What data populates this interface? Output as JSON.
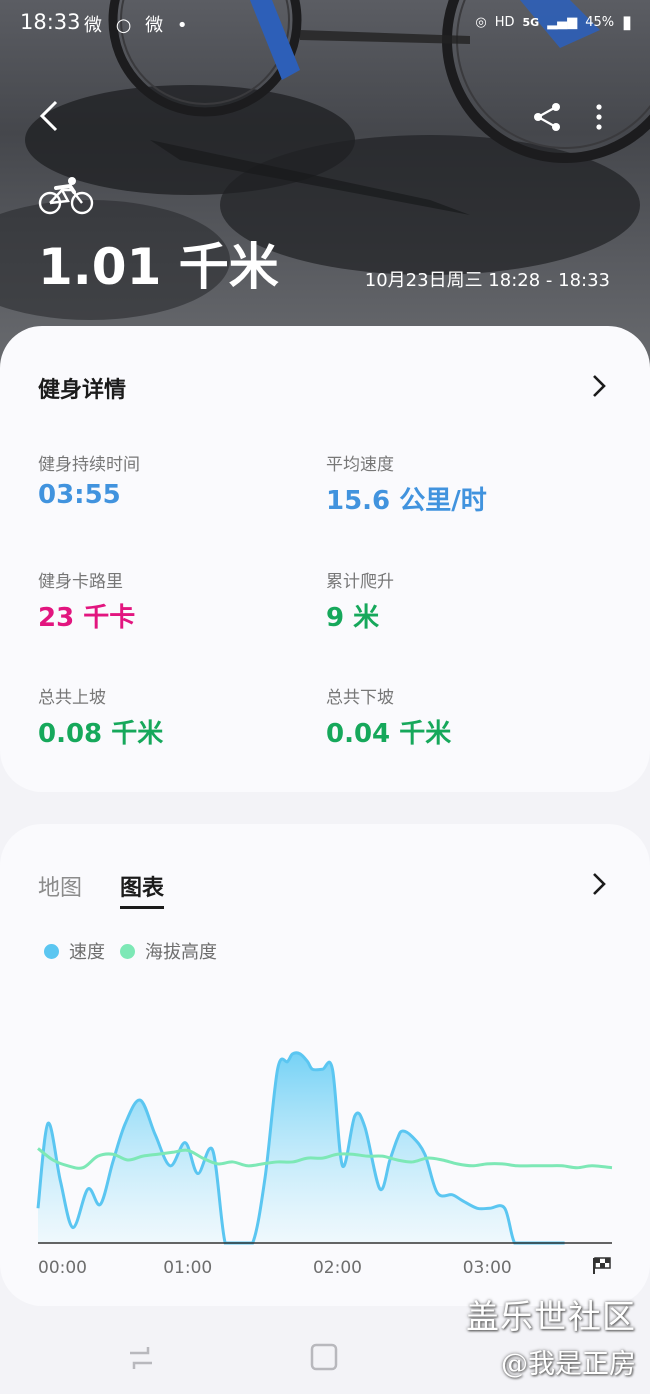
{
  "status_bar": {
    "time": "18:33",
    "left_icons": "微 ○ 微 •",
    "hd": "HD",
    "network": "5G",
    "battery": "45%"
  },
  "hero": {
    "activity_icon": "cycling-icon",
    "distance": "1.01 千米",
    "datetime": "10月23日周三 18:28 - 18:33"
  },
  "details": {
    "title": "健身详情",
    "stats": [
      {
        "label": "健身持续时间",
        "value": "03:55",
        "color": "#4193de"
      },
      {
        "label": "平均速度",
        "value": "15.6 公里/时",
        "color": "#4193de"
      },
      {
        "label": "健身卡路里",
        "value": "23 千卡",
        "color": "#e2157f"
      },
      {
        "label": "累计爬升",
        "value": "9 米",
        "color": "#16a85b"
      },
      {
        "label": "总共上坡",
        "value": "0.08 千米",
        "color": "#16a85b"
      },
      {
        "label": "总共下坡",
        "value": "0.04 千米",
        "color": "#16a85b"
      }
    ]
  },
  "chart_section": {
    "tabs": [
      {
        "label": "地图",
        "selected": false
      },
      {
        "label": "图表",
        "selected": true
      }
    ],
    "legend": [
      {
        "label": "速度",
        "color": "#5bc6f1"
      },
      {
        "label": "海拔高度",
        "color": "#7de8b6"
      }
    ]
  },
  "chart_data": {
    "type": "area",
    "x_unit": "minutes",
    "x_ticks": [
      "00:00",
      "01:00",
      "02:00",
      "03:00"
    ],
    "x_tick_values": [
      0,
      60,
      120,
      180
    ],
    "xlim": [
      0,
      230
    ],
    "ylim": [
      0,
      100
    ],
    "end_icon": "checkered-flag-icon",
    "series": [
      {
        "name": "速度",
        "color": "#5bc6f1",
        "x": [
          0,
          4,
          9,
          14,
          20,
          25,
          30,
          35,
          41,
          47,
          53,
          59,
          64,
          70,
          75,
          80,
          86,
          91,
          96,
          100,
          102,
          105,
          108,
          110,
          114,
          118,
          122,
          127,
          131,
          137,
          141,
          144,
          146,
          150,
          155,
          160,
          166,
          170,
          176,
          181,
          187,
          191,
          196,
          201,
          206,
          211
        ],
        "values": [
          18,
          62,
          32,
          8,
          28,
          20,
          42,
          62,
          74,
          56,
          40,
          52,
          36,
          48,
          0,
          0,
          0,
          34,
          90,
          94,
          98,
          98,
          94,
          90,
          90,
          90,
          40,
          66,
          60,
          28,
          43,
          54,
          58,
          55,
          46,
          26,
          25,
          22,
          18,
          18,
          18,
          0,
          0,
          0,
          0,
          0
        ]
      },
      {
        "name": "海拔高度",
        "color": "#7de8b6",
        "x": [
          0,
          6,
          12,
          18,
          24,
          30,
          36,
          42,
          48,
          54,
          60,
          66,
          72,
          78,
          84,
          90,
          96,
          102,
          108,
          114,
          120,
          126,
          132,
          138,
          144,
          150,
          156,
          162,
          168,
          174,
          180,
          186,
          192,
          198,
          204,
          210,
          216,
          222,
          230
        ],
        "values": [
          49,
          43,
          40,
          39,
          45,
          46,
          43,
          45,
          46,
          47,
          48,
          44,
          41,
          42,
          40,
          41,
          42,
          42,
          44,
          44,
          46,
          46,
          45,
          45,
          43,
          42,
          44,
          43,
          41,
          40,
          41,
          41,
          40,
          40,
          40,
          40,
          39,
          40,
          39
        ]
      }
    ]
  },
  "watermark": {
    "line1": "盖乐世社区",
    "line2": "@我是正房"
  }
}
